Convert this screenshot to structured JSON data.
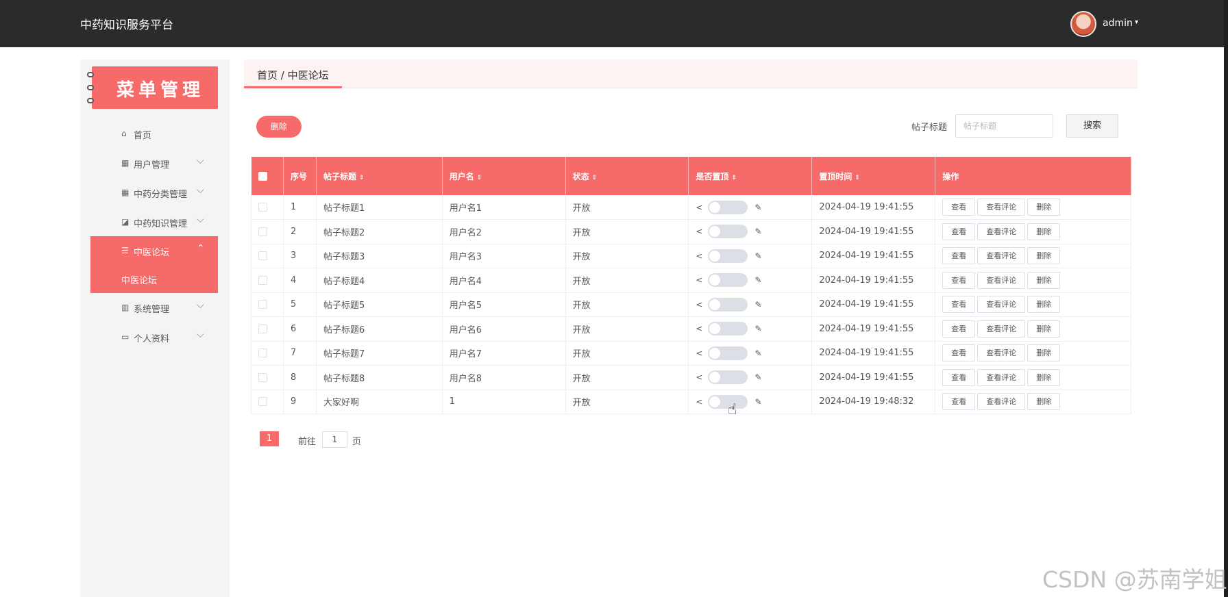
{
  "header": {
    "app_title": "中药知识服务平台",
    "username": "admin",
    "caret": "▾"
  },
  "sidebar": {
    "banner_title": "菜单管理",
    "items": [
      {
        "icon": "home-icon",
        "glyph": "⌂",
        "label": "首页",
        "chevron": ""
      },
      {
        "icon": "grid-icon",
        "glyph": "▦",
        "label": "用户管理",
        "chevron": "⌵"
      },
      {
        "icon": "grid-icon",
        "glyph": "▦",
        "label": "中药分类管理",
        "chevron": "⌵"
      },
      {
        "icon": "chart-icon",
        "glyph": "◪",
        "label": "中药知识管理",
        "chevron": "⌵"
      },
      {
        "icon": "list-icon",
        "glyph": "☰",
        "label": "中医论坛",
        "chevron": "⌃"
      },
      {
        "icon": "bar-icon",
        "glyph": "▥",
        "label": "系统管理",
        "chevron": "⌵"
      },
      {
        "icon": "card-icon",
        "glyph": "▭",
        "label": "个人资料",
        "chevron": "⌵"
      }
    ],
    "subitem": "中医论坛"
  },
  "breadcrumb": "首页 / 中医论坛",
  "toolbar": {
    "delete_label": "删除",
    "search_label": "帖子标题",
    "search_placeholder": "帖子标题",
    "search_button": "搜索"
  },
  "table": {
    "headers": [
      "序号",
      "帖子标题",
      "用户名",
      "状态",
      "是否置顶",
      "置顶时间",
      "操作"
    ],
    "sort_glyph": "⇕",
    "rows": [
      {
        "no": "1",
        "title": "帖子标题1",
        "user": "用户名1",
        "status": "开放",
        "time": "2024-04-19 19:41:55"
      },
      {
        "no": "2",
        "title": "帖子标题2",
        "user": "用户名2",
        "status": "开放",
        "time": "2024-04-19 19:41:55"
      },
      {
        "no": "3",
        "title": "帖子标题3",
        "user": "用户名3",
        "status": "开放",
        "time": "2024-04-19 19:41:55"
      },
      {
        "no": "4",
        "title": "帖子标题4",
        "user": "用户名4",
        "status": "开放",
        "time": "2024-04-19 19:41:55"
      },
      {
        "no": "5",
        "title": "帖子标题5",
        "user": "用户名5",
        "status": "开放",
        "time": "2024-04-19 19:41:55"
      },
      {
        "no": "6",
        "title": "帖子标题6",
        "user": "用户名6",
        "status": "开放",
        "time": "2024-04-19 19:41:55"
      },
      {
        "no": "7",
        "title": "帖子标题7",
        "user": "用户名7",
        "status": "开放",
        "time": "2024-04-19 19:41:55"
      },
      {
        "no": "8",
        "title": "帖子标题8",
        "user": "用户名8",
        "status": "开放",
        "time": "2024-04-19 19:41:55"
      },
      {
        "no": "9",
        "title": "大家好啊",
        "user": "1",
        "status": "开放",
        "time": "2024-04-19 19:48:32"
      }
    ],
    "actions": [
      "查看",
      "查看评论",
      "删除"
    ]
  },
  "pagination": {
    "current_page": "1",
    "goto_label": "前往",
    "goto_value": "1",
    "page_label": "页"
  },
  "watermark": "CSDN @苏南学姐",
  "colors": {
    "accent": "#f66a69",
    "topbar": "#2b2b2b",
    "sidebar": "#f4f4f5"
  }
}
